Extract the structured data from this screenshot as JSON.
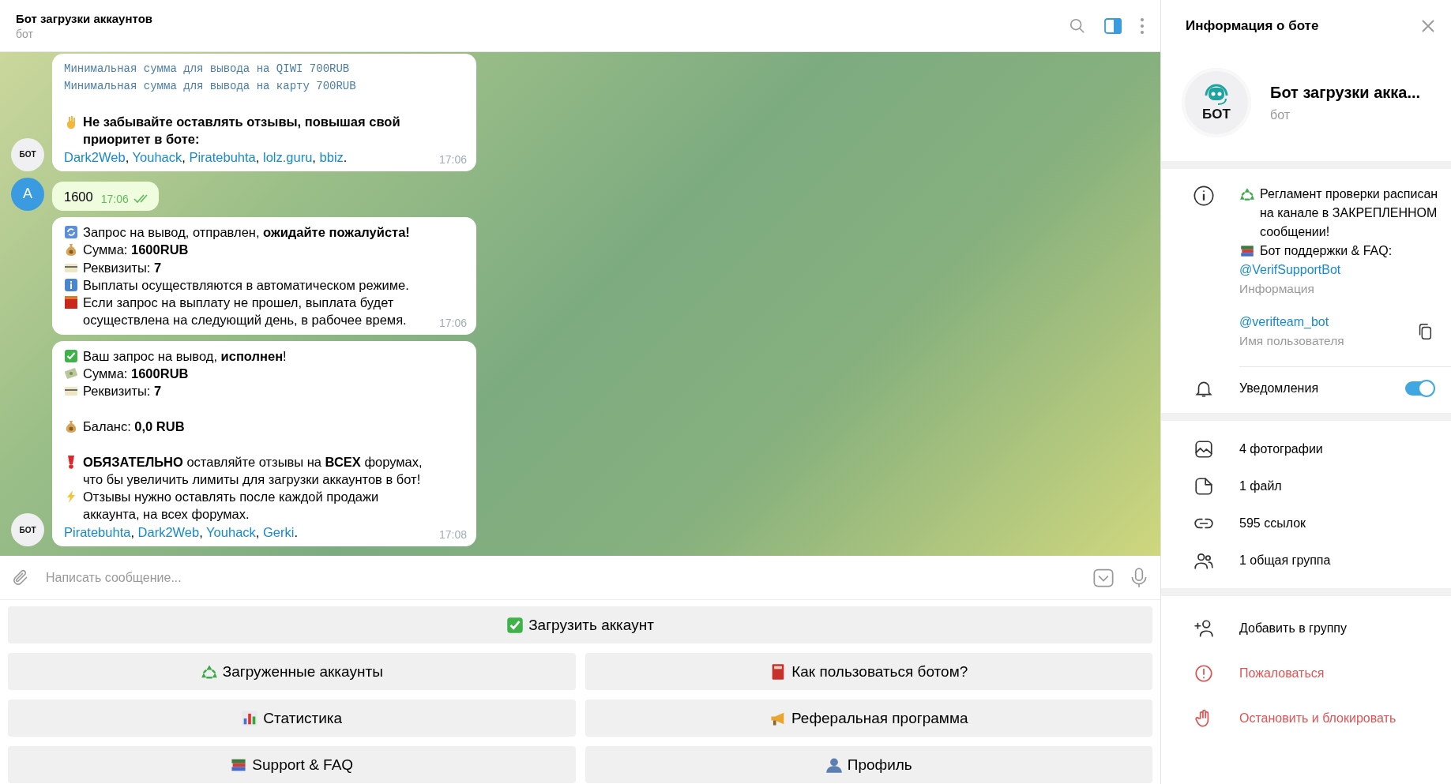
{
  "header": {
    "title": "Бот загрузки аккаунтов",
    "status": "бот",
    "panel_open": true
  },
  "messages": [
    {
      "kind": "incoming",
      "avatar_text": "БОТ",
      "time": "17:06",
      "lines": [
        {
          "kind": "mono",
          "text": "Минимальная сумма для вывода на QIWI 700RUB"
        },
        {
          "kind": "mono",
          "text": "Минимальная сумма для вывода на карту 700RUB"
        },
        {
          "kind": "blank"
        },
        {
          "kind": "hand",
          "bold": true,
          "text": "Не забывайте оставлять отзывы, повышая свой приоритет в боте:"
        },
        {
          "kind": "links",
          "links": [
            "Dark2Web",
            "Youhack",
            "Piratebuhta",
            "lolz.guru",
            "bbiz"
          ],
          "separator": ", ",
          "end": "."
        }
      ]
    },
    {
      "kind": "outgoing",
      "avatar_text": "A",
      "time": "17:06",
      "read": true,
      "lines": [
        {
          "kind": "plain",
          "text": "1600"
        }
      ]
    },
    {
      "kind": "incoming",
      "time": "17:06",
      "lines": [
        {
          "kind": "refresh",
          "text": "Запрос на вывод,  отправлен, **ожидайте пожалуйста!**"
        },
        {
          "kind": "money-bag",
          "text": "Сумма: **1600RUB**"
        },
        {
          "kind": "card",
          "text": "Реквизиты: **7**"
        },
        {
          "kind": "info",
          "text": "Выплаты осуществляются в автоматическом режиме."
        },
        {
          "kind": "stop",
          "text": "Если запрос на выплату не прошел, выплата будет осуществлена на следующий день, в рабочее время."
        }
      ]
    },
    {
      "kind": "incoming",
      "avatar_text": "БОТ",
      "time": "17:08",
      "lines": [
        {
          "kind": "check",
          "text": "Ваш запрос на вывод, **исполнен**!"
        },
        {
          "kind": "banknote",
          "text": "Сумма: **1600RUB**"
        },
        {
          "kind": "card",
          "text": "Реквизиты: **7**"
        },
        {
          "kind": "blank"
        },
        {
          "kind": "money-bag",
          "text": "Баланс: **0,0 RUB**"
        },
        {
          "kind": "blank"
        },
        {
          "kind": "exclamation",
          "text": "**ОБЯЗАТЕЛЬНО** оставляйте отзывы на **ВСЕХ** форумах, что бы увеличить лимиты для загрузки аккаунтов в бот!"
        },
        {
          "kind": "lightning",
          "text": "Отзывы нужно оставлять после каждой продажи аккаунта, на всех форумах."
        },
        {
          "kind": "links",
          "links": [
            "Piratebuhta",
            "Dark2Web",
            "Youhack",
            "Gerki"
          ],
          "separator": ", ",
          "end": "."
        }
      ]
    }
  ],
  "composer": {
    "placeholder": "Написать сообщение..."
  },
  "keyboard": [
    [
      {
        "kind": "check",
        "label": "Загрузить аккаунт"
      }
    ],
    [
      {
        "kind": "recycle",
        "label": "Загруженные аккаунты"
      },
      {
        "kind": "book",
        "label": "Как пользоваться ботом?"
      }
    ],
    [
      {
        "kind": "chart",
        "label": "Статистика"
      },
      {
        "kind": "megaphone",
        "label": "Реферальная программа"
      }
    ],
    [
      {
        "kind": "books",
        "label": "Support & FAQ"
      },
      {
        "kind": "person",
        "label": "Профиль"
      }
    ]
  ],
  "panel": {
    "title": "Информация о боте",
    "avatar_text": "БОТ",
    "name": "Бот загрузки акка...",
    "subtitle": "бот",
    "description": [
      {
        "kind": "recycle",
        "text": "Регламент проверки расписан на канале в ЗАКРЕПЛЕННОМ сообщении!"
      },
      {
        "kind": "books",
        "text": "Бот поддержки & FAQ:"
      }
    ],
    "description_link": "@VerifSupportBot",
    "description_label": "Информация",
    "username": "@verifteam_bot",
    "username_label": "Имя пользователя",
    "notifications_label": "Уведомления",
    "notifications_on": true,
    "media": [
      {
        "kind": "photo",
        "label": "4 фотографии"
      },
      {
        "kind": "file",
        "label": "1 файл"
      },
      {
        "kind": "link",
        "label": "595 ссылок"
      },
      {
        "kind": "group",
        "label": "1 общая группа"
      }
    ],
    "actions": [
      {
        "kind": "add-user",
        "label": "Добавить в группу",
        "danger": false
      },
      {
        "kind": "report",
        "label": "Пожаловаться",
        "danger": true
      },
      {
        "kind": "block",
        "label": "Остановить и блокировать",
        "danger": true
      }
    ]
  }
}
